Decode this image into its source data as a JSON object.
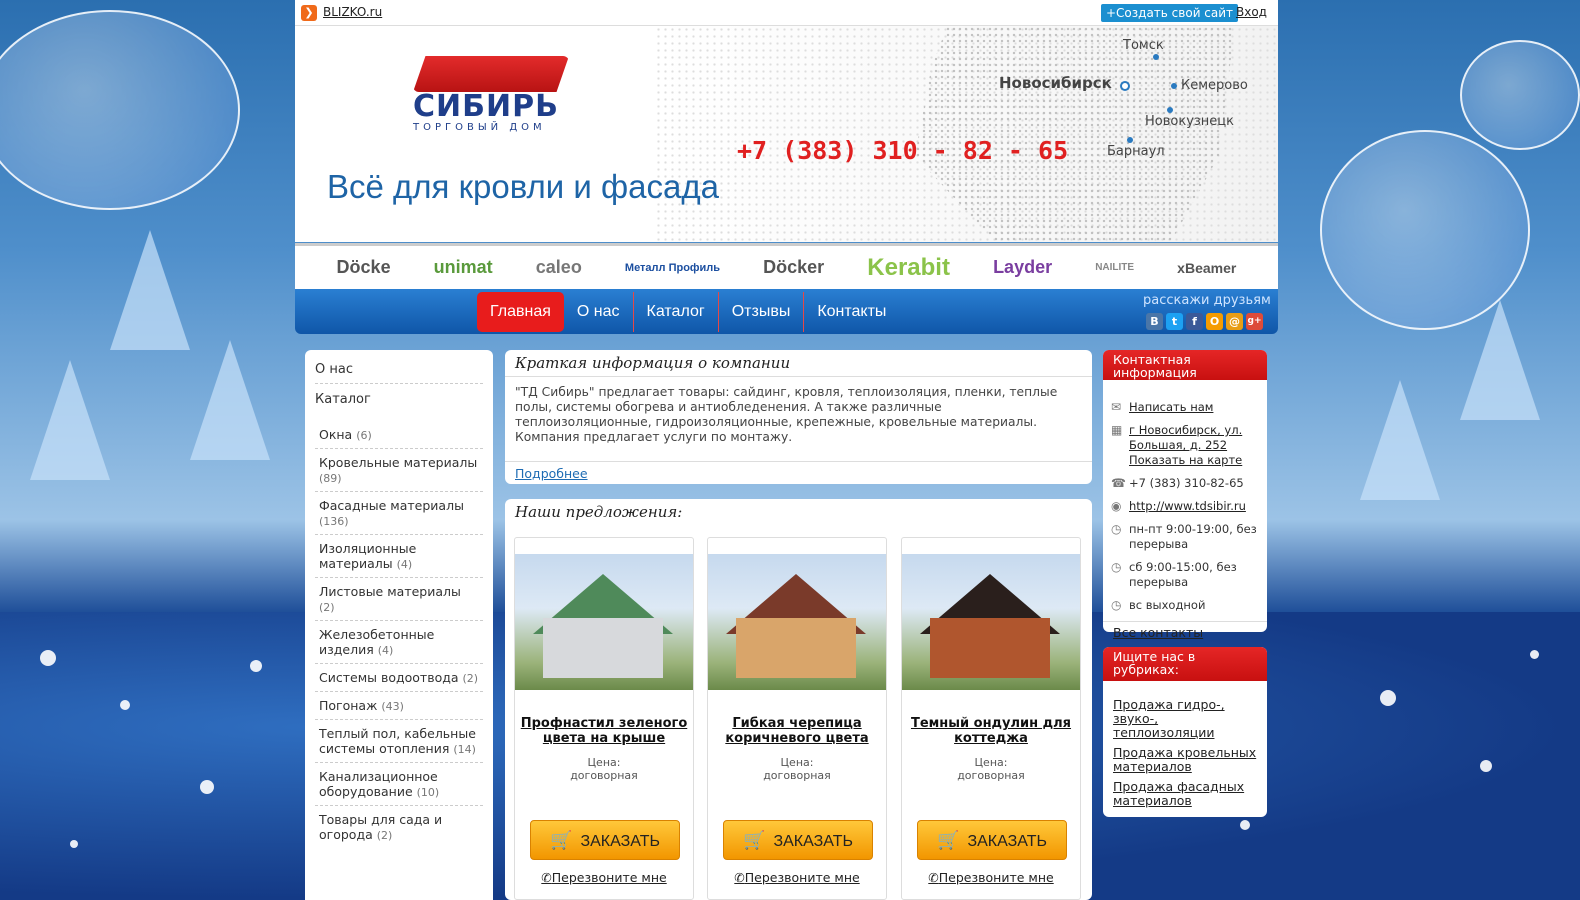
{
  "topbar": {
    "site_link": "BLIZKO.ru",
    "create_button": "+Создать свой сайт",
    "login": "Вход"
  },
  "header": {
    "logo_name": "СИБИРЬ",
    "logo_sub": "ТОРГОВЫЙ ДОМ",
    "slogan": "Всё для кровли и фасада",
    "phone": "+7 (383) 310 - 82 - 65",
    "cities": [
      "Томск",
      "Новосибирск",
      "Кемерово",
      "Новокузнецк",
      "Барнаул"
    ]
  },
  "brands": [
    "Döcke",
    "unimat",
    "caleo",
    "Металл Профиль",
    "Döcker",
    "Kerabit",
    "Layder",
    "NAILITE",
    "xBeamer"
  ],
  "brand_colors": [
    "#555555",
    "#5a9a3c",
    "#777777",
    "#1c4fa0",
    "#555555",
    "#8bc34a",
    "#7a3ea0",
    "#888888",
    "#555555"
  ],
  "nav": {
    "items": [
      "Главная",
      "О нас",
      "Каталог",
      "Отзывы",
      "Контакты"
    ],
    "share_label": "расскажи друзьям",
    "share_icons": [
      {
        "icon": "vk-icon",
        "glyph": "В",
        "color": "#4a76a8"
      },
      {
        "icon": "twitter-icon",
        "glyph": "t",
        "color": "#1da1f2"
      },
      {
        "icon": "facebook-icon",
        "glyph": "f",
        "color": "#3b5998"
      },
      {
        "icon": "odnoklassniki-icon",
        "glyph": "О",
        "color": "#f59b00"
      },
      {
        "icon": "mailru-icon",
        "glyph": "@",
        "color": "#e89d16"
      },
      {
        "icon": "googleplus-icon",
        "glyph": "g+",
        "color": "#dd4b39"
      }
    ]
  },
  "sidebar": {
    "top_links": [
      "О нас",
      "Каталог"
    ],
    "categories": [
      {
        "name": "Окна",
        "count": "(6)"
      },
      {
        "name": "Кровельные материалы",
        "count": "(89)"
      },
      {
        "name": "Фасадные материалы",
        "count": "(136)"
      },
      {
        "name": "Изоляционные материалы",
        "count": "(4)"
      },
      {
        "name": "Листовые материалы",
        "count": "(2)"
      },
      {
        "name": "Железобетонные изделия",
        "count": "(4)"
      },
      {
        "name": "Системы водоотвода",
        "count": "(2)"
      },
      {
        "name": "Погонаж",
        "count": "(43)"
      },
      {
        "name": "Теплый пол, кабельные системы отопления",
        "count": "(14)"
      },
      {
        "name": "Канализационное оборудование",
        "count": "(10)"
      },
      {
        "name": "Товары для сада и огорода",
        "count": "(2)"
      }
    ]
  },
  "info": {
    "title": "Краткая информация о компании",
    "text": "\"ТД Сибирь\" предлагает товары: сайдинг, кровля, теплоизоляция, пленки, теплые полы, системы обогрева и антиобледенения. А также различные теплоизоляционные, гидроизоляционные, крепежные, кровельные материалы. Компания предлагает услуги по монтажу.",
    "more": "Подробнее"
  },
  "offers": {
    "title": "Наши предложения:",
    "order_label": "ЗАКАЗАТЬ",
    "callback_label": "Перезвоните мне",
    "items": [
      {
        "name": "Профнастил зеленого цвета на крыше",
        "price_label": "Цена:",
        "price": "договорная",
        "roof_color": "#4f8a5a",
        "wall_color": "#d7d9dc"
      },
      {
        "name": "Гибкая черепица коричневого цвета",
        "price_label": "Цена:",
        "price": "договорная",
        "roof_color": "#7a3a2a",
        "wall_color": "#d9a56a"
      },
      {
        "name": "Темный ондулин для коттеджа",
        "price_label": "Цена:",
        "price": "договорная",
        "roof_color": "#2a1f1c",
        "wall_color": "#b0562e"
      }
    ]
  },
  "contacts": {
    "title": "Контактная информация",
    "write": "Написать нам",
    "address": "г Новосибирск, ул. Большая, д. 252",
    "show_map": "Показать на карте",
    "phone": "+7 (383) 310-82-65",
    "site": "http://www.tdsibir.ru",
    "hours": [
      "пн-пт 9:00-19:00, без перерыва",
      "сб 9:00-15:00, без перерыва",
      "вс выходной"
    ],
    "all_contacts": "Все контакты"
  },
  "rubrics": {
    "title": "Ищите нас в рубриках:",
    "links": [
      "Продажа гидро-, звуко-, теплоизоляции",
      "Продажа кровельных материалов",
      "Продажа фасадных материалов"
    ]
  },
  "colors": {
    "accent_red": "#e81c1c",
    "nav_blue": "#1565b8",
    "order_orange": "#f6a914"
  }
}
